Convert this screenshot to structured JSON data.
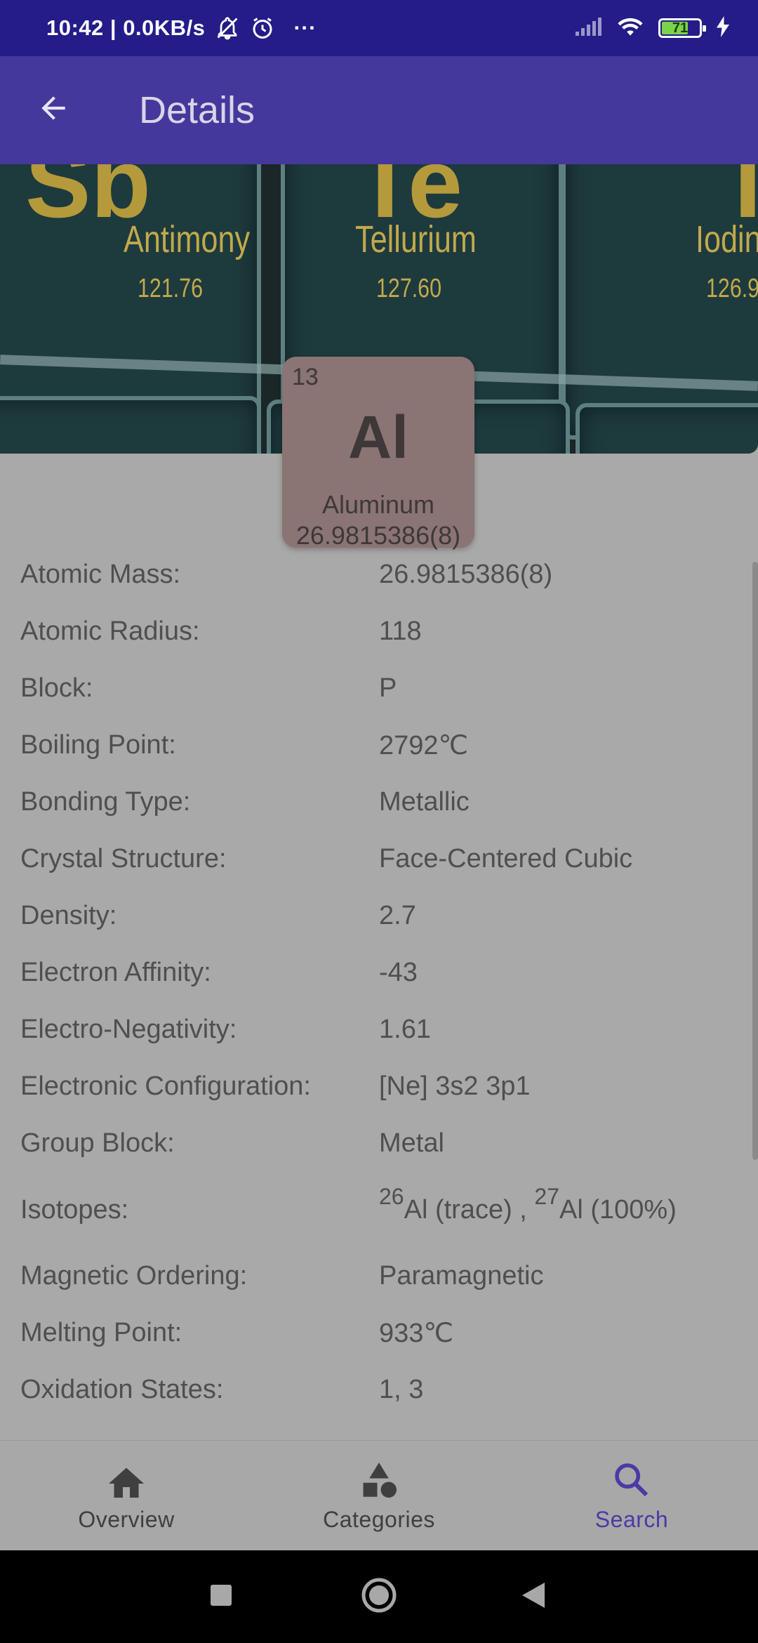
{
  "status_bar": {
    "time": "10:42",
    "network_speed": "0.0KB/s",
    "more": "···",
    "battery": "71",
    "icons": [
      "mute-notifications-icon",
      "alarm-icon",
      "signal-icon",
      "wifi-icon",
      "battery-icon",
      "charging-icon"
    ]
  },
  "app_bar": {
    "title": "Details",
    "back_icon": "arrow-back-icon"
  },
  "hero": {
    "tiles": [
      {
        "symbol": "Sb",
        "name": "Antimony",
        "mass": "121.76"
      },
      {
        "symbol": "Te",
        "name": "Tellurium",
        "mass": "127.60"
      },
      {
        "symbol": "I",
        "name": "Iodin",
        "mass": "126.9"
      }
    ]
  },
  "element": {
    "number": "13",
    "symbol": "Al",
    "name": "Aluminum",
    "mass": "26.9815386(8)",
    "card_color": "#8b7474"
  },
  "properties": [
    {
      "label": "Atomic Mass:",
      "value": "26.9815386(8)"
    },
    {
      "label": "Atomic Radius:",
      "value": "118"
    },
    {
      "label": "Block:",
      "value": "P"
    },
    {
      "label": "Boiling Point:",
      "value": "2792℃"
    },
    {
      "label": "Bonding Type:",
      "value": "Metallic"
    },
    {
      "label": "Crystal Structure:",
      "value": "Face-Centered Cubic"
    },
    {
      "label": "Density:",
      "value": "2.7"
    },
    {
      "label": "Electron Affinity:",
      "value": "-43"
    },
    {
      "label": "Electro-Negativity:",
      "value": "1.61"
    },
    {
      "label": "Electronic Configuration:",
      "value": "[Ne] 3s2 3p1"
    },
    {
      "label": "Group Block:",
      "value": "Metal"
    },
    {
      "label": "Isotopes:",
      "isotopes": [
        {
          "mass_number": "26",
          "text": "Al (trace) , "
        },
        {
          "mass_number": "27",
          "text": "Al (100%)"
        }
      ]
    },
    {
      "label": "Magnetic Ordering:",
      "value": "Paramagnetic"
    },
    {
      "label": "Melting Point:",
      "value": "933℃"
    },
    {
      "label": "Oxidation States:",
      "value": "1, 3"
    }
  ],
  "bottom_nav": [
    {
      "label": "Overview",
      "icon": "home-icon",
      "active": false
    },
    {
      "label": "Categories",
      "icon": "categories-icon",
      "active": false
    },
    {
      "label": "Search",
      "icon": "search-icon",
      "active": true
    }
  ],
  "colors": {
    "status_bar": "#241c88",
    "app_bar": "#45389c",
    "active_nav": "#4b3aa6",
    "background": "#a9a9a9"
  }
}
